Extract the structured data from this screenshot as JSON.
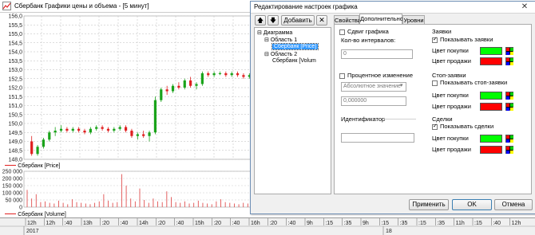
{
  "chart_window": {
    "title": "Сбербанк Графики цены и объема - [5 минут]",
    "price_legend": "Сбербанк [Price]",
    "volume_legend": "Сбербанк [Volume]",
    "price_ticks": [
      "156,0",
      "155,5",
      "155,0",
      "154,5",
      "154,0",
      "153,5",
      "153,0",
      "152,5",
      "152,0",
      "151,5",
      "151,0",
      "150,5",
      "150,0",
      "149,5",
      "149,0",
      "148,5",
      "148,0"
    ],
    "volume_ticks": [
      "250 000",
      "200 000",
      "150 000",
      "100 000",
      "50 000",
      "0"
    ],
    "time_labels": [
      "12h",
      "12h",
      ":40",
      "13h",
      ":20",
      ":40",
      "14h",
      ":20",
      ":40",
      "15h",
      ":20",
      ":40",
      "16h",
      ":20",
      ":40",
      "9h",
      ":15",
      ":35",
      "9h",
      ":15",
      ":35",
      ":15",
      ":35",
      "11h",
      ":15",
      ":40",
      "12h"
    ],
    "date_labels": [
      "2017",
      "18"
    ],
    "colors": {
      "up": "#1aa31a",
      "down": "#e02020",
      "volume": "#e05050"
    }
  },
  "chart_data": [
    {
      "type": "candlestick",
      "title": "Сбербанк [Price]",
      "ylim": [
        148.0,
        156.0
      ],
      "series": [
        {
          "name": "Сбербанк [Price]",
          "ohlc": [
            [
              149.0,
              149.3,
              148.2,
              148.3
            ],
            [
              148.3,
              148.8,
              148.2,
              148.7
            ],
            [
              148.7,
              149.2,
              148.6,
              149.1
            ],
            [
              149.1,
              149.6,
              149.0,
              149.5
            ],
            [
              149.5,
              149.8,
              149.3,
              149.6
            ],
            [
              149.6,
              149.9,
              149.5,
              149.7
            ],
            [
              149.7,
              149.8,
              149.5,
              149.6
            ],
            [
              149.6,
              149.8,
              149.5,
              149.7
            ],
            [
              149.7,
              149.8,
              149.5,
              149.6
            ],
            [
              149.6,
              149.7,
              149.4,
              149.5
            ],
            [
              149.5,
              149.8,
              149.4,
              149.7
            ],
            [
              149.7,
              149.9,
              149.6,
              149.8
            ],
            [
              149.8,
              149.9,
              149.6,
              149.7
            ],
            [
              149.7,
              149.8,
              149.5,
              149.6
            ],
            [
              149.6,
              149.8,
              149.5,
              149.7
            ],
            [
              149.7,
              149.9,
              149.6,
              149.8
            ],
            [
              149.8,
              149.9,
              149.5,
              149.6
            ],
            [
              149.6,
              149.7,
              149.2,
              149.3
            ],
            [
              149.3,
              149.5,
              149.1,
              149.4
            ],
            [
              149.4,
              149.6,
              149.2,
              149.3
            ],
            [
              149.3,
              149.6,
              149.0,
              149.5
            ],
            [
              149.5,
              151.5,
              149.4,
              151.3
            ],
            [
              151.3,
              152.0,
              151.2,
              151.9
            ],
            [
              151.9,
              152.1,
              151.6,
              151.8
            ],
            [
              151.8,
              152.2,
              151.7,
              152.1
            ],
            [
              152.1,
              152.3,
              151.9,
              152.0
            ],
            [
              152.0,
              152.5,
              151.9,
              152.4
            ],
            [
              152.4,
              152.6,
              152.0,
              152.1
            ],
            [
              152.1,
              152.3,
              151.9,
              152.2
            ],
            [
              152.2,
              152.9,
              152.1,
              152.8
            ],
            [
              152.8,
              152.9,
              152.6,
              152.7
            ],
            [
              152.7,
              152.9,
              152.6,
              152.8
            ],
            [
              152.8,
              152.9,
              152.7,
              152.8
            ],
            [
              152.8,
              152.9,
              152.6,
              152.7
            ],
            [
              152.7,
              152.9,
              152.6,
              152.8
            ],
            [
              152.8,
              152.9,
              152.6,
              152.7
            ],
            [
              152.7,
              152.8,
              152.5,
              152.6
            ],
            [
              152.6,
              152.8,
              152.5,
              152.7
            ]
          ]
        }
      ]
    },
    {
      "type": "bar",
      "title": "Сбербанк [Volume]",
      "ylim": [
        0,
        250000
      ],
      "series": [
        {
          "name": "Сбербанк [Volume]",
          "values": [
            120000,
            60000,
            90000,
            35000,
            40000,
            30000,
            25000,
            45000,
            30000,
            20000,
            55000,
            35000,
            30000,
            25000,
            20000,
            30000,
            40000,
            90000,
            45000,
            30000,
            35000,
            230000,
            150000,
            60000,
            40000,
            130000,
            50000,
            30000,
            60000,
            40000,
            35000,
            110000,
            70000,
            35000,
            30000,
            40000,
            25000,
            30000,
            45000,
            30000,
            25000,
            20000,
            40000,
            55000,
            35000,
            30000,
            25000,
            20000,
            30000,
            25000
          ]
        }
      ]
    }
  ],
  "dialog": {
    "title": "Редактирование настроек графика",
    "close_glyph": "✕",
    "toolbar": {
      "up_glyph": "🡅",
      "down_glyph": "🡇",
      "add_label": "Добавить",
      "delete_glyph": "✕"
    },
    "tree": [
      {
        "label": "Диаграмма",
        "prefix": "⊟"
      },
      {
        "label": "Область 1",
        "prefix": "⊟"
      },
      {
        "label": "Сбербанк [Price]",
        "prefix": ""
      },
      {
        "label": "Область 2",
        "prefix": "⊟"
      },
      {
        "label": "Сбербанк [Volum",
        "prefix": ""
      }
    ],
    "tabs": [
      "Свойства",
      "Дополнительно",
      "Уровни"
    ],
    "shift": {
      "label": "Сдвиг графика",
      "intervals_label": "Кол-во интервалов:",
      "intervals_value": "0"
    },
    "percent": {
      "label": "Процентное изменение",
      "select_value": "Абсолютное значение",
      "value": "0,000000"
    },
    "identifier": {
      "label": "Идентификатор",
      "value": ""
    },
    "orders": {
      "group": "Заявки",
      "show_label": "Показывать заявки",
      "buy_label": "Цвет покупки",
      "sell_label": "Цвет продажи",
      "buy_color": "#00ff00",
      "sell_color": "#ff0000"
    },
    "stop_orders": {
      "group": "Стоп-заявки",
      "show_label": "Показывать стоп-заявки",
      "buy_label": "Цвет покупки",
      "sell_label": "Цвет продажи",
      "buy_color": "#00ff00",
      "sell_color": "#ff0000"
    },
    "trades": {
      "group": "Сделки",
      "show_label": "Показывать сделки",
      "buy_label": "Цвет покупки",
      "sell_label": "Цвет продажи",
      "buy_color": "#00ff00",
      "sell_color": "#ff0000"
    },
    "buttons": {
      "apply": "Применить",
      "ok": "OK",
      "cancel": "Отмена"
    }
  }
}
